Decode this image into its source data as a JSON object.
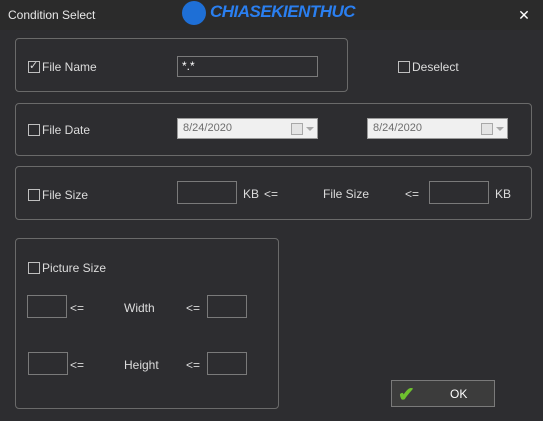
{
  "window": {
    "title": "Condition Select",
    "close_glyph": "✕",
    "logo_text": "CHIASEKIENTHUC"
  },
  "file_name": {
    "label": "File Name",
    "checked": true,
    "value": "*.*"
  },
  "deselect": {
    "label": "Deselect",
    "checked": false
  },
  "file_date": {
    "label": "File Date",
    "checked": false,
    "from": "8/24/2020",
    "to": "8/24/2020"
  },
  "file_size": {
    "label": "File Size",
    "checked": false,
    "min_value": "",
    "unit1": "KB",
    "op1": "<=",
    "middle_label": "File Size",
    "op2": "<=",
    "max_value": "",
    "unit2": "KB"
  },
  "picture_size": {
    "label": "Picture Size",
    "checked": false,
    "width_label": "Width",
    "height_label": "Height",
    "op": "<=",
    "width_min": "",
    "width_max": "",
    "height_min": "",
    "height_max": ""
  },
  "ok_button": {
    "label": "OK"
  },
  "colors": {
    "background": "#2d2d30",
    "check_green": "#6ec22e",
    "logo_blue": "#2a7ff0"
  }
}
